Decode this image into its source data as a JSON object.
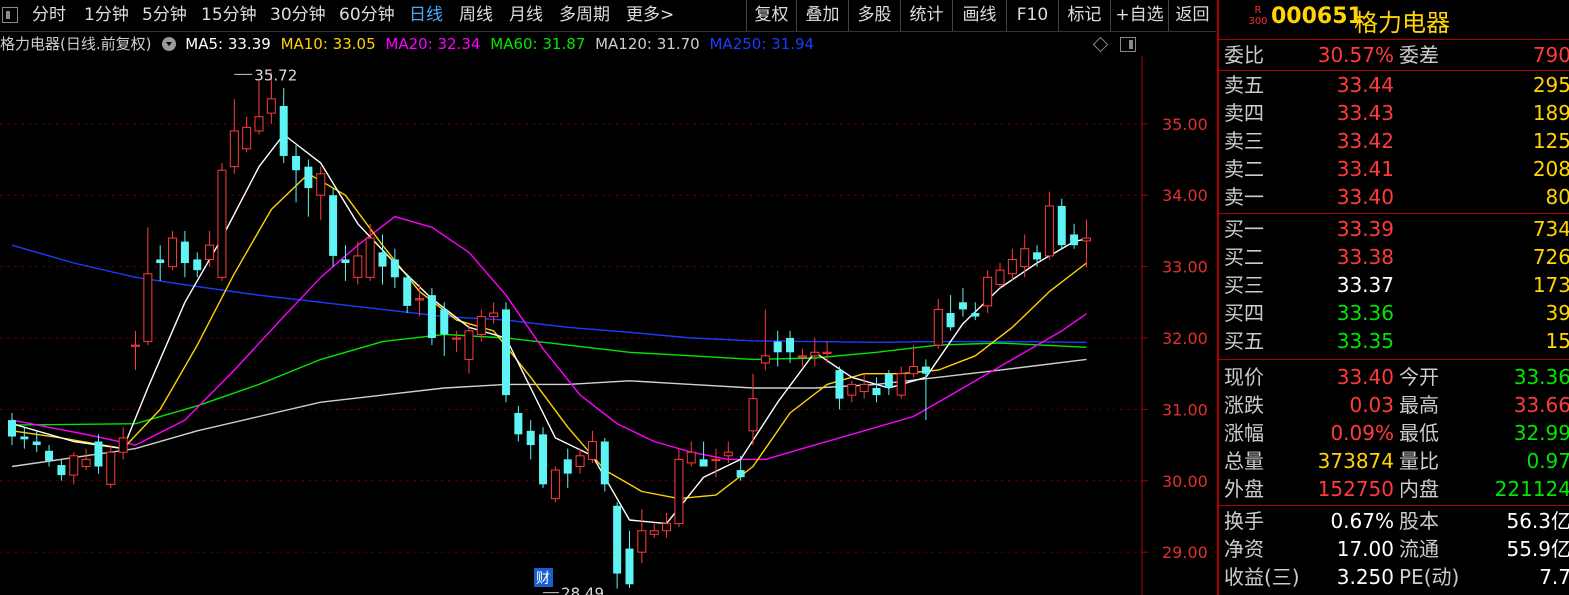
{
  "toolbar": {
    "tabs": [
      {
        "label": "分时",
        "active": false
      },
      {
        "label": "1分钟",
        "active": false
      },
      {
        "label": "5分钟",
        "active": false
      },
      {
        "label": "15分钟",
        "active": false
      },
      {
        "label": "30分钟",
        "active": false
      },
      {
        "label": "60分钟",
        "active": false
      },
      {
        "label": "日线",
        "active": true
      },
      {
        "label": "周线",
        "active": false
      },
      {
        "label": "月线",
        "active": false
      },
      {
        "label": "多周期",
        "active": false
      },
      {
        "label": "更多>",
        "active": false
      }
    ],
    "buttons": [
      "复权",
      "叠加",
      "多股",
      "统计",
      "画线",
      "F10",
      "标记",
      "+自选",
      "返回"
    ]
  },
  "legend": {
    "stock_label": "格力电器(日线.前复权)",
    "items": [
      {
        "text": "MA5: 33.39",
        "color": "#ffffff"
      },
      {
        "text": "MA10: 33.05",
        "color": "#ffd400"
      },
      {
        "text": "MA20: 32.34",
        "color": "#ff00ff"
      },
      {
        "text": "MA60: 31.87",
        "color": "#00e600"
      },
      {
        "text": "MA120: 31.70",
        "color": "#d0d0d0"
      },
      {
        "text": "MA250: 31.94",
        "color": "#1a3cff"
      }
    ]
  },
  "chart_data": {
    "type": "candlestick",
    "ylim": [
      28.4,
      35.95
    ],
    "yticks": [
      "35.00",
      "34.00",
      "33.00",
      "32.00",
      "31.00",
      "30.00",
      "29.00"
    ],
    "annotations": {
      "high": {
        "text": "35.72",
        "value": 35.72,
        "bar": 18
      },
      "low": {
        "text": "28.49",
        "value": 28.49,
        "bar": 43
      },
      "event_badge": {
        "text": "财",
        "bar": 43
      }
    },
    "candles": [
      {
        "o": 30.85,
        "c": 30.62,
        "h": 30.95,
        "l": 30.5
      },
      {
        "o": 30.62,
        "c": 30.58,
        "h": 30.75,
        "l": 30.45
      },
      {
        "o": 30.55,
        "c": 30.5,
        "h": 30.7,
        "l": 30.4
      },
      {
        "o": 30.42,
        "c": 30.28,
        "h": 30.5,
        "l": 30.2
      },
      {
        "o": 30.22,
        "c": 30.08,
        "h": 30.3,
        "l": 30.0
      },
      {
        "o": 30.08,
        "c": 30.35,
        "h": 30.4,
        "l": 29.95
      },
      {
        "o": 30.2,
        "c": 30.3,
        "h": 30.45,
        "l": 30.15
      },
      {
        "o": 30.55,
        "c": 30.2,
        "h": 30.65,
        "l": 30.1
      },
      {
        "o": 29.95,
        "c": 30.4,
        "h": 30.5,
        "l": 29.9
      },
      {
        "o": 30.4,
        "c": 30.6,
        "h": 30.75,
        "l": 30.3
      },
      {
        "o": 31.9,
        "c": 31.9,
        "h": 32.1,
        "l": 31.55
      },
      {
        "o": 31.95,
        "c": 32.9,
        "h": 33.55,
        "l": 31.9
      },
      {
        "o": 33.1,
        "c": 33.05,
        "h": 33.3,
        "l": 32.8
      },
      {
        "o": 33.0,
        "c": 33.4,
        "h": 33.5,
        "l": 32.95
      },
      {
        "o": 33.35,
        "c": 33.05,
        "h": 33.5,
        "l": 32.85
      },
      {
        "o": 33.1,
        "c": 32.95,
        "h": 33.2,
        "l": 32.85
      },
      {
        "o": 33.1,
        "c": 33.3,
        "h": 33.5,
        "l": 33.0
      },
      {
        "o": 32.85,
        "c": 34.35,
        "h": 34.45,
        "l": 32.8
      },
      {
        "o": 34.4,
        "c": 34.9,
        "h": 35.35,
        "l": 34.3
      },
      {
        "o": 34.65,
        "c": 34.95,
        "h": 35.1,
        "l": 34.6
      },
      {
        "o": 34.9,
        "c": 35.1,
        "h": 35.6,
        "l": 34.85
      },
      {
        "o": 35.15,
        "c": 35.35,
        "h": 35.72,
        "l": 35.0
      },
      {
        "o": 35.25,
        "c": 34.55,
        "h": 35.5,
        "l": 34.45
      },
      {
        "o": 34.55,
        "c": 34.35,
        "h": 34.7,
        "l": 33.9
      },
      {
        "o": 34.4,
        "c": 34.1,
        "h": 34.5,
        "l": 33.7
      },
      {
        "o": 34.0,
        "c": 34.3,
        "h": 34.4,
        "l": 33.65
      },
      {
        "o": 34.0,
        "c": 33.15,
        "h": 34.1,
        "l": 33.0
      },
      {
        "o": 33.1,
        "c": 33.05,
        "h": 33.3,
        "l": 32.8
      },
      {
        "o": 32.85,
        "c": 33.15,
        "h": 33.35,
        "l": 32.75
      },
      {
        "o": 32.85,
        "c": 33.4,
        "h": 33.6,
        "l": 32.8
      },
      {
        "o": 33.2,
        "c": 33.0,
        "h": 33.45,
        "l": 32.75
      },
      {
        "o": 33.1,
        "c": 32.85,
        "h": 33.25,
        "l": 32.7
      },
      {
        "o": 32.85,
        "c": 32.45,
        "h": 32.9,
        "l": 32.35
      },
      {
        "o": 32.55,
        "c": 32.55,
        "h": 32.75,
        "l": 32.3
      },
      {
        "o": 32.6,
        "c": 32.0,
        "h": 32.7,
        "l": 31.9
      },
      {
        "o": 32.4,
        "c": 32.05,
        "h": 32.5,
        "l": 31.75
      },
      {
        "o": 32.0,
        "c": 32.0,
        "h": 32.1,
        "l": 31.8
      },
      {
        "o": 31.7,
        "c": 32.1,
        "h": 32.2,
        "l": 31.5
      },
      {
        "o": 32.05,
        "c": 32.3,
        "h": 32.4,
        "l": 31.95
      },
      {
        "o": 32.3,
        "c": 32.35,
        "h": 32.5,
        "l": 32.2
      },
      {
        "o": 32.4,
        "c": 31.2,
        "h": 32.5,
        "l": 31.1
      },
      {
        "o": 30.95,
        "c": 30.65,
        "h": 31.05,
        "l": 30.55
      },
      {
        "o": 30.7,
        "c": 30.5,
        "h": 30.85,
        "l": 30.3
      },
      {
        "o": 30.65,
        "c": 29.95,
        "h": 30.75,
        "l": 29.9
      },
      {
        "o": 29.75,
        "c": 30.15,
        "h": 30.2,
        "l": 29.7
      },
      {
        "o": 30.3,
        "c": 30.1,
        "h": 30.45,
        "l": 29.9
      },
      {
        "o": 30.2,
        "c": 30.35,
        "h": 30.45,
        "l": 30.1
      },
      {
        "o": 30.3,
        "c": 30.55,
        "h": 30.7,
        "l": 30.25
      },
      {
        "o": 30.55,
        "c": 29.95,
        "h": 30.6,
        "l": 29.85
      },
      {
        "o": 29.65,
        "c": 28.7,
        "h": 29.7,
        "l": 28.49
      },
      {
        "o": 29.05,
        "c": 28.55,
        "h": 29.3,
        "l": 28.5
      },
      {
        "o": 29.0,
        "c": 29.3,
        "h": 29.6,
        "l": 28.85
      },
      {
        "o": 29.25,
        "c": 29.3,
        "h": 29.4,
        "l": 29.2
      },
      {
        "o": 29.3,
        "c": 29.4,
        "h": 29.55,
        "l": 29.2
      },
      {
        "o": 29.4,
        "c": 30.3,
        "h": 30.45,
        "l": 29.35
      },
      {
        "o": 30.25,
        "c": 30.4,
        "h": 30.55,
        "l": 30.2
      },
      {
        "o": 30.3,
        "c": 30.2,
        "h": 30.55,
        "l": 30.2
      },
      {
        "o": 30.3,
        "c": 30.3,
        "h": 30.45,
        "l": 30.05
      },
      {
        "o": 30.35,
        "c": 30.4,
        "h": 30.55,
        "l": 30.25
      },
      {
        "o": 30.15,
        "c": 30.05,
        "h": 30.35,
        "l": 30.0
      },
      {
        "o": 30.7,
        "c": 31.15,
        "h": 31.5,
        "l": 30.5
      },
      {
        "o": 31.65,
        "c": 31.75,
        "h": 32.4,
        "l": 31.55
      },
      {
        "o": 31.95,
        "c": 31.8,
        "h": 32.1,
        "l": 31.6
      },
      {
        "o": 32.0,
        "c": 31.8,
        "h": 32.1,
        "l": 31.65
      },
      {
        "o": 31.75,
        "c": 31.75,
        "h": 31.85,
        "l": 31.6
      },
      {
        "o": 31.75,
        "c": 31.8,
        "h": 32.0,
        "l": 31.6
      },
      {
        "o": 31.8,
        "c": 31.8,
        "h": 31.95,
        "l": 31.65
      },
      {
        "o": 31.55,
        "c": 31.15,
        "h": 31.6,
        "l": 31.0
      },
      {
        "o": 31.2,
        "c": 31.35,
        "h": 31.4,
        "l": 31.1
      },
      {
        "o": 31.25,
        "c": 31.35,
        "h": 31.5,
        "l": 31.15
      },
      {
        "o": 31.3,
        "c": 31.2,
        "h": 31.45,
        "l": 31.1
      },
      {
        "o": 31.5,
        "c": 31.3,
        "h": 31.55,
        "l": 31.2
      },
      {
        "o": 31.2,
        "c": 31.5,
        "h": 31.6,
        "l": 31.15
      },
      {
        "o": 31.5,
        "c": 31.6,
        "h": 31.9,
        "l": 31.45
      },
      {
        "o": 31.6,
        "c": 31.5,
        "h": 31.7,
        "l": 30.85
      },
      {
        "o": 31.9,
        "c": 32.4,
        "h": 32.55,
        "l": 31.85
      },
      {
        "o": 32.35,
        "c": 32.15,
        "h": 32.6,
        "l": 32.1
      },
      {
        "o": 32.5,
        "c": 32.4,
        "h": 32.7,
        "l": 32.3
      },
      {
        "o": 32.35,
        "c": 32.3,
        "h": 32.5,
        "l": 32.25
      },
      {
        "o": 32.45,
        "c": 32.85,
        "h": 32.95,
        "l": 32.35
      },
      {
        "o": 32.75,
        "c": 32.95,
        "h": 33.05,
        "l": 32.7
      },
      {
        "o": 32.9,
        "c": 33.1,
        "h": 33.25,
        "l": 32.8
      },
      {
        "o": 33.0,
        "c": 33.25,
        "h": 33.45,
        "l": 32.85
      },
      {
        "o": 33.2,
        "c": 33.1,
        "h": 33.3,
        "l": 33.0
      },
      {
        "o": 33.15,
        "c": 33.85,
        "h": 34.05,
        "l": 33.1
      },
      {
        "o": 33.85,
        "c": 33.3,
        "h": 33.95,
        "l": 33.25
      },
      {
        "o": 33.45,
        "c": 33.3,
        "h": 33.6,
        "l": 33.25
      },
      {
        "o": 33.36,
        "c": 33.4,
        "h": 33.66,
        "l": 32.99
      }
    ],
    "ma": {
      "MA5": [
        [
          0,
          30.8
        ],
        [
          5,
          30.55
        ],
        [
          9,
          30.45
        ],
        [
          11,
          31.3
        ],
        [
          14,
          32.5
        ],
        [
          17,
          33.4
        ],
        [
          20,
          34.4
        ],
        [
          22,
          34.85
        ],
        [
          25,
          34.45
        ],
        [
          28,
          33.6
        ],
        [
          31,
          33.05
        ],
        [
          34,
          32.55
        ],
        [
          37,
          32.15
        ],
        [
          40,
          32.0
        ],
        [
          42,
          31.3
        ],
        [
          44,
          30.6
        ],
        [
          47,
          30.35
        ],
        [
          50,
          29.45
        ],
        [
          53,
          29.4
        ],
        [
          56,
          30.05
        ],
        [
          59,
          30.3
        ],
        [
          62,
          31.1
        ],
        [
          65,
          31.8
        ],
        [
          68,
          31.45
        ],
        [
          71,
          31.3
        ],
        [
          74,
          31.45
        ],
        [
          77,
          32.2
        ],
        [
          80,
          32.7
        ],
        [
          83,
          33.05
        ],
        [
          86,
          33.35
        ],
        [
          87,
          33.39
        ]
      ],
      "MA10": [
        [
          0,
          30.7
        ],
        [
          4,
          30.6
        ],
        [
          9,
          30.45
        ],
        [
          12,
          31.0
        ],
        [
          15,
          31.9
        ],
        [
          18,
          32.9
        ],
        [
          21,
          33.8
        ],
        [
          24,
          34.3
        ],
        [
          27,
          34.0
        ],
        [
          30,
          33.3
        ],
        [
          33,
          32.65
        ],
        [
          36,
          32.25
        ],
        [
          39,
          32.1
        ],
        [
          42,
          31.45
        ],
        [
          45,
          30.75
        ],
        [
          48,
          30.15
        ],
        [
          51,
          29.85
        ],
        [
          54,
          29.75
        ],
        [
          57,
          29.8
        ],
        [
          60,
          30.2
        ],
        [
          63,
          30.95
        ],
        [
          66,
          31.35
        ],
        [
          69,
          31.5
        ],
        [
          72,
          31.5
        ],
        [
          75,
          31.55
        ],
        [
          78,
          31.75
        ],
        [
          81,
          32.15
        ],
        [
          84,
          32.65
        ],
        [
          87,
          33.05
        ]
      ],
      "MA20": [
        [
          0,
          30.85
        ],
        [
          6,
          30.65
        ],
        [
          10,
          30.5
        ],
        [
          14,
          30.85
        ],
        [
          18,
          31.55
        ],
        [
          22,
          32.3
        ],
        [
          25,
          32.85
        ],
        [
          28,
          33.3
        ],
        [
          31,
          33.7
        ],
        [
          34,
          33.55
        ],
        [
          37,
          33.2
        ],
        [
          40,
          32.6
        ],
        [
          43,
          31.85
        ],
        [
          46,
          31.2
        ],
        [
          49,
          30.8
        ],
        [
          52,
          30.55
        ],
        [
          55,
          30.4
        ],
        [
          58,
          30.3
        ],
        [
          61,
          30.3
        ],
        [
          64,
          30.45
        ],
        [
          67,
          30.6
        ],
        [
          70,
          30.75
        ],
        [
          73,
          30.9
        ],
        [
          76,
          31.2
        ],
        [
          79,
          31.5
        ],
        [
          82,
          31.8
        ],
        [
          85,
          32.1
        ],
        [
          87,
          32.34
        ]
      ],
      "MA60": [
        [
          0,
          30.78
        ],
        [
          10,
          30.8
        ],
        [
          15,
          31.05
        ],
        [
          20,
          31.35
        ],
        [
          25,
          31.7
        ],
        [
          30,
          31.95
        ],
        [
          35,
          32.05
        ],
        [
          40,
          32.0
        ],
        [
          45,
          31.9
        ],
        [
          50,
          31.8
        ],
        [
          55,
          31.75
        ],
        [
          60,
          31.7
        ],
        [
          65,
          31.72
        ],
        [
          70,
          31.8
        ],
        [
          75,
          31.9
        ],
        [
          80,
          31.93
        ],
        [
          87,
          31.87
        ]
      ],
      "MA120": [
        [
          0,
          30.2
        ],
        [
          10,
          30.45
        ],
        [
          15,
          30.7
        ],
        [
          20,
          30.9
        ],
        [
          25,
          31.1
        ],
        [
          30,
          31.2
        ],
        [
          35,
          31.3
        ],
        [
          40,
          31.35
        ],
        [
          45,
          31.35
        ],
        [
          50,
          31.4
        ],
        [
          55,
          31.35
        ],
        [
          60,
          31.3
        ],
        [
          65,
          31.3
        ],
        [
          70,
          31.35
        ],
        [
          75,
          31.45
        ],
        [
          80,
          31.55
        ],
        [
          87,
          31.7
        ]
      ],
      "MA250": [
        [
          0,
          33.3
        ],
        [
          5,
          33.05
        ],
        [
          10,
          32.85
        ],
        [
          15,
          32.72
        ],
        [
          20,
          32.6
        ],
        [
          25,
          32.5
        ],
        [
          30,
          32.4
        ],
        [
          35,
          32.3
        ],
        [
          40,
          32.25
        ],
        [
          45,
          32.15
        ],
        [
          50,
          32.08
        ],
        [
          55,
          32.0
        ],
        [
          60,
          31.96
        ],
        [
          65,
          31.95
        ],
        [
          70,
          31.94
        ],
        [
          75,
          31.95
        ],
        [
          80,
          31.95
        ],
        [
          87,
          31.94
        ]
      ]
    },
    "colors": {
      "up": "#ff3b3b",
      "down": "#5ff4f4",
      "MA5": "#ffffff",
      "MA10": "#ffd400",
      "MA20": "#ff00ff",
      "MA60": "#00e600",
      "MA120": "#d0d0d0",
      "MA250": "#1a3cff",
      "grid": "#5a0000",
      "axis": "#b00000",
      "tick_text": "#e03030"
    }
  },
  "quote": {
    "badge_top": "R",
    "badge_bottom": "300",
    "code": "000651",
    "name": "格力电器",
    "ratio": {
      "label": "委比",
      "value": "30.57%",
      "label2": "委差",
      "value2": "790"
    },
    "asks": [
      {
        "label": "卖五",
        "price": "33.44",
        "vol": "295"
      },
      {
        "label": "卖四",
        "price": "33.43",
        "vol": "189"
      },
      {
        "label": "卖三",
        "price": "33.42",
        "vol": "125"
      },
      {
        "label": "卖二",
        "price": "33.41",
        "vol": "208"
      },
      {
        "label": "卖一",
        "price": "33.40",
        "vol": "80"
      }
    ],
    "bids": [
      {
        "label": "买一",
        "price": "33.39",
        "vol": "734"
      },
      {
        "label": "买二",
        "price": "33.38",
        "vol": "726"
      },
      {
        "label": "买三",
        "price": "33.37",
        "vol": "173"
      },
      {
        "label": "买四",
        "price": "33.36",
        "vol": "39"
      },
      {
        "label": "买五",
        "price": "33.35",
        "vol": "15"
      }
    ],
    "stats": [
      {
        "label": "现价",
        "value": "33.40",
        "label2": "今开",
        "value2": "33.36"
      },
      {
        "label": "涨跌",
        "value": "0.03",
        "label2": "最高",
        "value2": "33.66"
      },
      {
        "label": "涨幅",
        "value": "0.09%",
        "label2": "最低",
        "value2": "32.99"
      },
      {
        "label": "总量",
        "value": "373874",
        "label2": "量比",
        "value2": "0.97"
      },
      {
        "label": "外盘",
        "value": "152750",
        "label2": "内盘",
        "value2": "221124"
      }
    ],
    "fundamentals": [
      {
        "label": "换手",
        "value": "0.67%",
        "label2": "股本",
        "value2": "56.3亿"
      },
      {
        "label": "净资",
        "value": "17.00",
        "label2": "流通",
        "value2": "55.9亿"
      },
      {
        "label": "收益(三)",
        "value": "3.250",
        "label2": "PE(动)",
        "value2": "7.7"
      }
    ]
  }
}
